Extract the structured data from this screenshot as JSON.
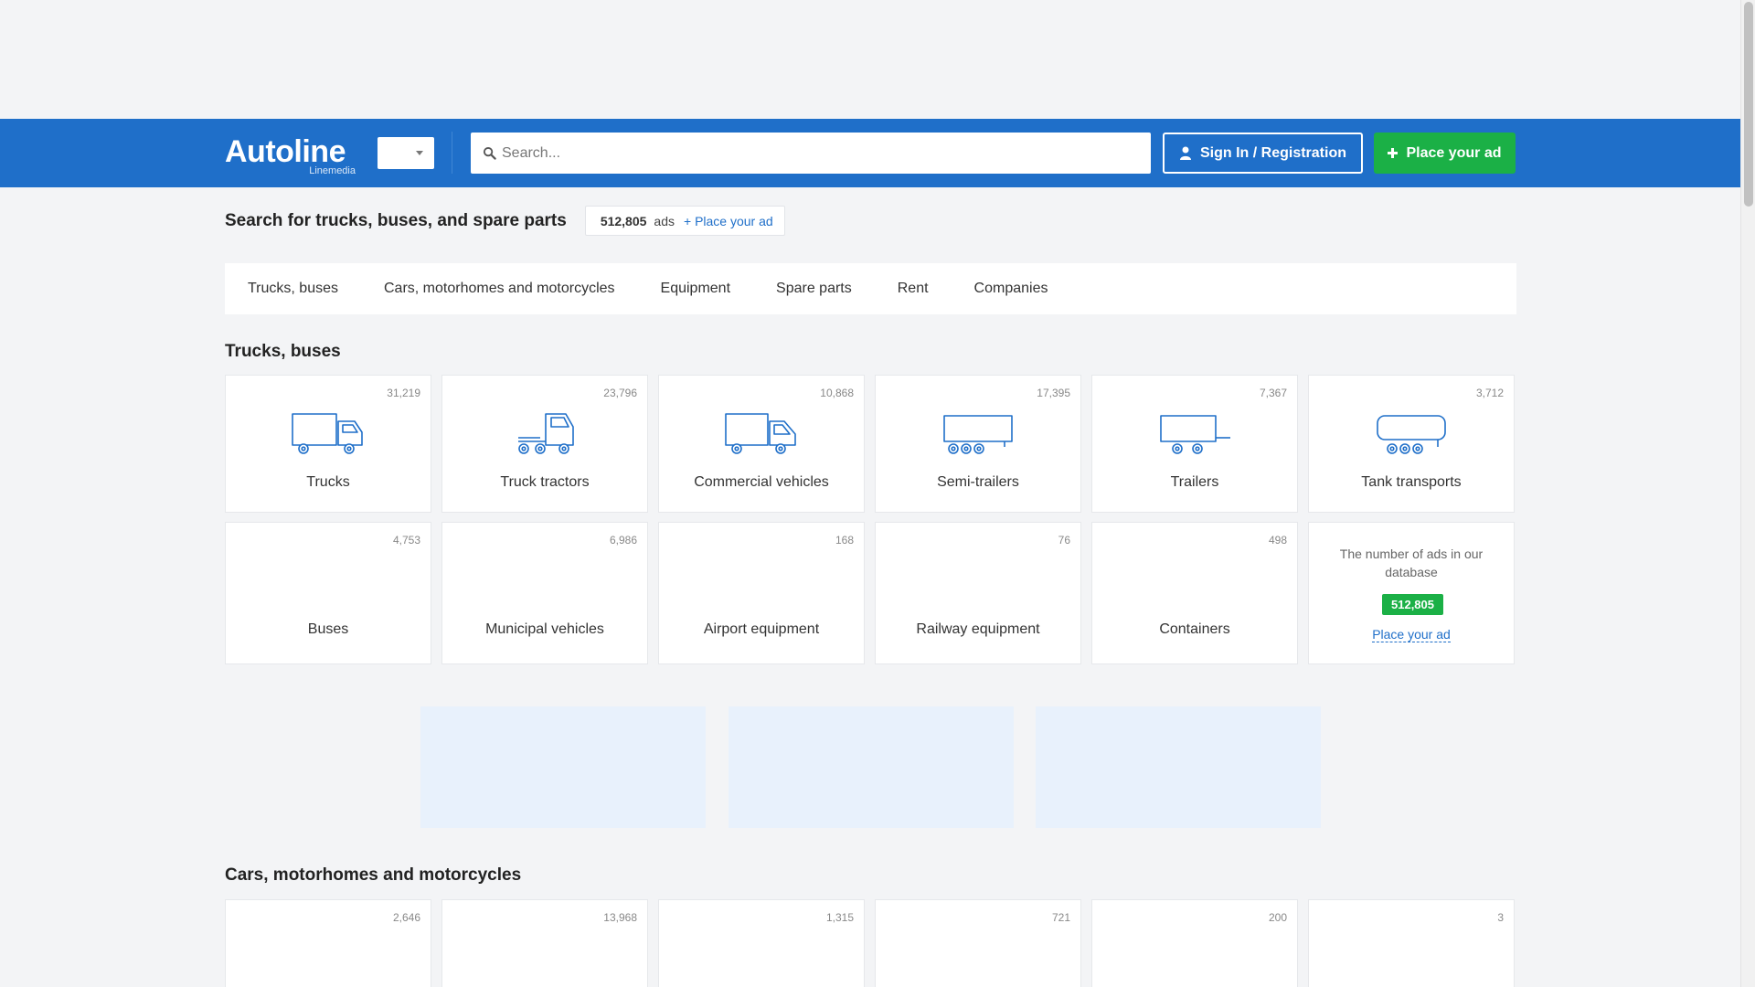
{
  "header": {
    "logo_text": "Autoline",
    "logo_sub": "Linemedia",
    "search_placeholder": "Search...",
    "signin_label": "Sign In / Registration",
    "place_ad_label": "Place your ad",
    "brand_color": "#1f6fc9",
    "accent_color": "#1bb046"
  },
  "hero": {
    "title": "Search for trucks, buses, and spare parts",
    "ads_count": "512,805",
    "ads_label": "ads",
    "place_ad_link": "+ Place your ad"
  },
  "tabs": [
    {
      "label": "Trucks, buses"
    },
    {
      "label": "Cars, motorhomes and motorcycles"
    },
    {
      "label": "Equipment"
    },
    {
      "label": "Spare parts"
    },
    {
      "label": "Rent"
    },
    {
      "label": "Companies"
    }
  ],
  "trucks_section": {
    "title": "Trucks, buses",
    "categories": [
      {
        "label": "Trucks",
        "count": "31,219",
        "icon": "truck-icon"
      },
      {
        "label": "Truck tractors",
        "count": "23,796",
        "icon": "truck-tractor-icon"
      },
      {
        "label": "Commercial vehicles",
        "count": "10,868",
        "icon": "van-icon"
      },
      {
        "label": "Semi-trailers",
        "count": "17,395",
        "icon": "semi-trailer-icon"
      },
      {
        "label": "Trailers",
        "count": "7,367",
        "icon": "trailer-icon"
      },
      {
        "label": "Tank transports",
        "count": "3,712",
        "icon": "tank-trailer-icon"
      },
      {
        "label": "Buses",
        "count": "4,753"
      },
      {
        "label": "Municipal vehicles",
        "count": "6,986"
      },
      {
        "label": "Airport equipment",
        "count": "168"
      },
      {
        "label": "Railway equipment",
        "count": "76"
      },
      {
        "label": "Containers",
        "count": "498"
      }
    ],
    "info_card": {
      "text": "The number of ads in our database",
      "count": "512,805",
      "link": "Place your ad"
    }
  },
  "cars_section": {
    "title": "Cars, motorhomes and motorcycles",
    "categories": [
      {
        "count": "2,646"
      },
      {
        "count": "13,968"
      },
      {
        "count": "1,315"
      },
      {
        "count": "721"
      },
      {
        "count": "200"
      },
      {
        "count": "3"
      }
    ]
  }
}
